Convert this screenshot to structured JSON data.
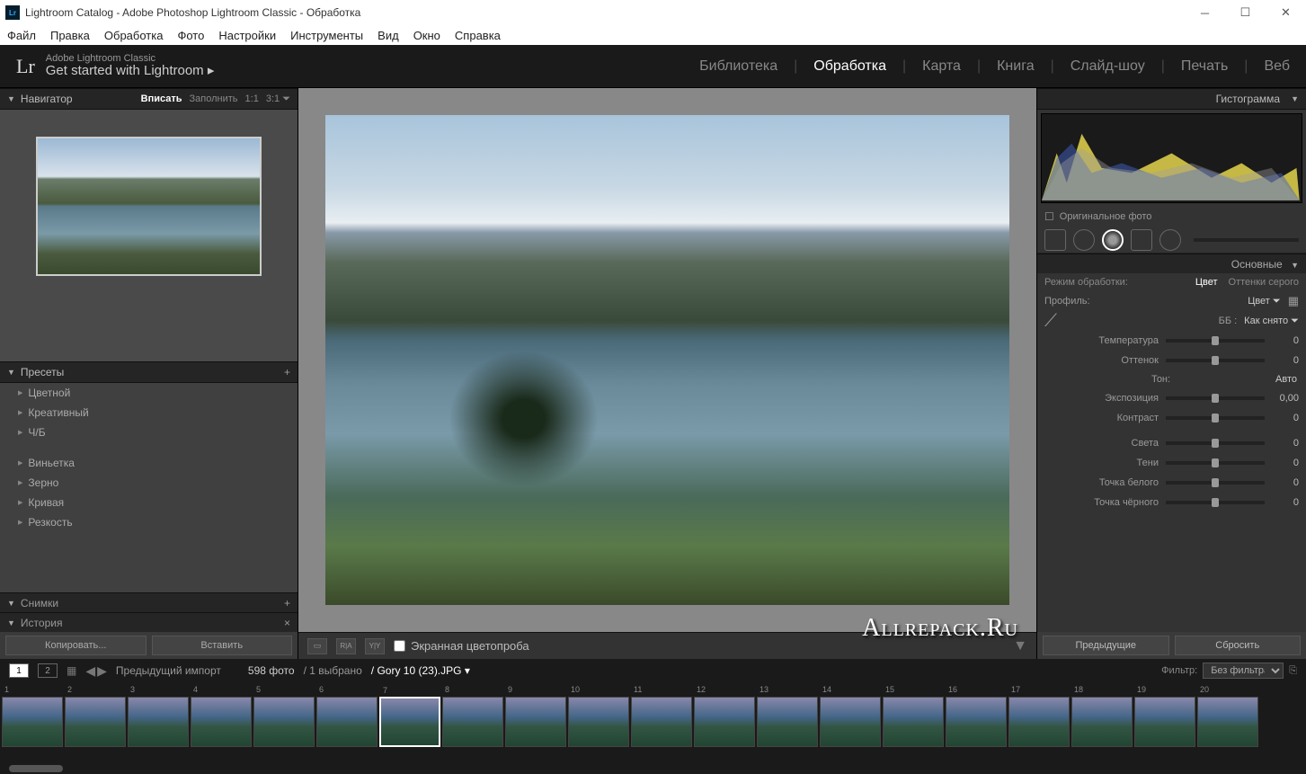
{
  "window": {
    "title": "Lightroom Catalog - Adobe Photoshop Lightroom Classic - Обработка"
  },
  "menu": [
    "Файл",
    "Правка",
    "Обработка",
    "Фото",
    "Настройки",
    "Инструменты",
    "Вид",
    "Окно",
    "Справка"
  ],
  "header": {
    "brand": "Lr",
    "subtitle": "Adobe Lightroom Classic",
    "title": "Get started with Lightroom ▸"
  },
  "modules": [
    "Библиотека",
    "Обработка",
    "Карта",
    "Книга",
    "Слайд-шоу",
    "Печать",
    "Веб"
  ],
  "active_module": "Обработка",
  "navigator": {
    "label": "Навигатор",
    "fit": "Вписать",
    "fill": "Заполнить",
    "one": "1:1",
    "three": "3:1 ⏷"
  },
  "presets": {
    "label": "Пресеты",
    "items": [
      "Цветной",
      "Креативный",
      "Ч/Б",
      "Виньетка",
      "Зерно",
      "Кривая",
      "Резкость"
    ]
  },
  "snapshots_label": "Снимки",
  "history_label": "История",
  "copy_btn": "Копировать...",
  "paste_btn": "Вставить",
  "center_toolbar": {
    "soft_proof": "Экранная цветопроба"
  },
  "bottom": {
    "prev_import": "Предыдущий импорт",
    "count": "598 фото",
    "selected": "/ 1 выбрано",
    "filename": "/ Gory 10 (23).JPG ▾",
    "filter_label": "Фильтр:",
    "filter_value": "Без фильтра"
  },
  "histogram_label": "Гистограмма",
  "original_photo": "Оригинальное фото",
  "basic": {
    "label": "Основные",
    "treatment_label": "Режим обработки:",
    "color": "Цвет",
    "bw": "Оттенки серого",
    "profile_label": "Профиль:",
    "profile_value": "Цвет ⏷",
    "wb_label": "ББ :",
    "wb_value": "Как снято ⏷",
    "tone_label": "Тон:",
    "auto": "Авто",
    "sliders": [
      {
        "label": "Температура",
        "value": "0"
      },
      {
        "label": "Оттенок",
        "value": "0"
      },
      {
        "label": "Экспозиция",
        "value": "0,00"
      },
      {
        "label": "Контраст",
        "value": "0"
      },
      {
        "label": "Света",
        "value": "0"
      },
      {
        "label": "Тени",
        "value": "0"
      },
      {
        "label": "Точка белого",
        "value": "0"
      },
      {
        "label": "Точка чёрного",
        "value": "0"
      }
    ]
  },
  "right_btns": {
    "prev": "Предыдущие",
    "reset": "Сбросить"
  },
  "watermark": "Allrepack.Ru",
  "thumbnails_count": 20,
  "selected_thumb": 7
}
